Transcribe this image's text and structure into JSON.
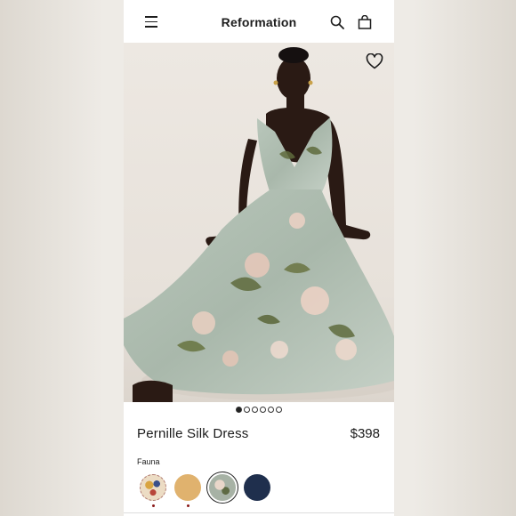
{
  "header": {
    "brand": "Reformation",
    "icons": [
      "menu-icon",
      "search-icon",
      "bag-icon"
    ]
  },
  "gallery": {
    "image_count": 6,
    "active_index": 0,
    "wishlist_icon": "heart-icon"
  },
  "product": {
    "name": "Pernille Silk Dress",
    "price": "$398",
    "color_name": "Fauna"
  },
  "swatches": [
    {
      "name": "floral-multicolor",
      "color": "#e9dcc6",
      "selected": false,
      "low_stock": true
    },
    {
      "name": "tan",
      "color": "#e0b26e",
      "selected": false,
      "low_stock": true
    },
    {
      "name": "fauna",
      "color": "#9aa498",
      "selected": true,
      "low_stock": false
    },
    {
      "name": "navy",
      "color": "#1f2f4d",
      "selected": false,
      "low_stock": false
    }
  ]
}
